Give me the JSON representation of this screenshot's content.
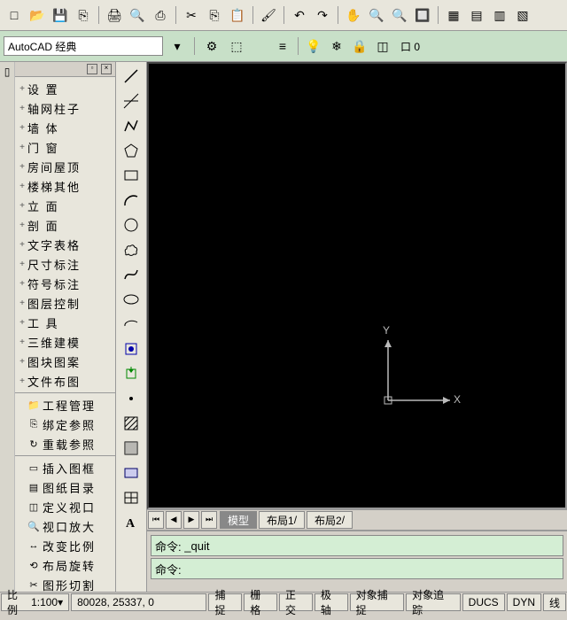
{
  "workspace": {
    "label": "AutoCAD 经典"
  },
  "top_tools": [
    {
      "name": "new-icon",
      "glyph": "□"
    },
    {
      "name": "open-icon",
      "glyph": "📂"
    },
    {
      "name": "save-icon",
      "glyph": "💾"
    },
    {
      "name": "saveall-icon",
      "glyph": "⎘"
    },
    {
      "name": "sep"
    },
    {
      "name": "plot-icon",
      "glyph": "🖨"
    },
    {
      "name": "preview-icon",
      "glyph": "🔍"
    },
    {
      "name": "publish-icon",
      "glyph": "⎙"
    },
    {
      "name": "sep"
    },
    {
      "name": "cut-icon",
      "glyph": "✂"
    },
    {
      "name": "copy-icon",
      "glyph": "⎘"
    },
    {
      "name": "paste-icon",
      "glyph": "📋"
    },
    {
      "name": "sep"
    },
    {
      "name": "match-icon",
      "glyph": "🖌"
    },
    {
      "name": "sep"
    },
    {
      "name": "undo-icon",
      "glyph": "↶"
    },
    {
      "name": "redo-icon",
      "glyph": "↷"
    },
    {
      "name": "sep"
    },
    {
      "name": "pan-icon",
      "glyph": "✋"
    },
    {
      "name": "zoom-icon",
      "glyph": "🔍"
    },
    {
      "name": "zoomprev-icon",
      "glyph": "🔍"
    },
    {
      "name": "zoomwin-icon",
      "glyph": "🔲"
    },
    {
      "name": "sep"
    },
    {
      "name": "props-icon",
      "glyph": "▦"
    },
    {
      "name": "dc-icon",
      "glyph": "▤"
    },
    {
      "name": "toolpal-icon",
      "glyph": "▥"
    },
    {
      "name": "markup-icon",
      "glyph": "▧"
    }
  ],
  "layer_tools": [
    {
      "name": "layer-icon",
      "glyph": "≡"
    },
    {
      "name": "sep"
    },
    {
      "name": "layeron-icon",
      "glyph": "💡"
    },
    {
      "name": "layerfrz-icon",
      "glyph": "❄"
    },
    {
      "name": "layerlock-icon",
      "glyph": "🔒"
    },
    {
      "name": "layercolor-icon",
      "glyph": "◫"
    }
  ],
  "layer_current": "口 0",
  "left_groups": [
    {
      "items": [
        {
          "exp": "+",
          "label": "设 置"
        },
        {
          "exp": "+",
          "label": "轴网柱子"
        },
        {
          "exp": "+",
          "label": "墙 体"
        },
        {
          "exp": "+",
          "label": "门 窗"
        },
        {
          "exp": "+",
          "label": "房间屋顶"
        },
        {
          "exp": "+",
          "label": "楼梯其他"
        },
        {
          "exp": "+",
          "label": "立 面"
        },
        {
          "exp": "+",
          "label": "剖 面"
        },
        {
          "exp": "+",
          "label": "文字表格"
        },
        {
          "exp": "+",
          "label": "尺寸标注"
        },
        {
          "exp": "+",
          "label": "符号标注"
        },
        {
          "exp": "+",
          "label": "图层控制"
        },
        {
          "exp": "+",
          "label": "工 具"
        },
        {
          "exp": "+",
          "label": "三维建模"
        },
        {
          "exp": "+",
          "label": "图块图案"
        },
        {
          "exp": "+",
          "label": "文件布图"
        }
      ]
    },
    {
      "items": [
        {
          "icon": "📁",
          "label": "工程管理"
        },
        {
          "icon": "⎘",
          "label": "绑定参照"
        },
        {
          "icon": "↻",
          "label": "重载参照"
        }
      ]
    },
    {
      "items": [
        {
          "icon": "▭",
          "label": "插入图框"
        },
        {
          "icon": "▤",
          "label": "图纸目录"
        },
        {
          "icon": "◫",
          "label": "定义视口"
        },
        {
          "icon": "🔍",
          "label": "视口放大"
        },
        {
          "icon": "↔",
          "label": "改变比例"
        },
        {
          "icon": "⟲",
          "label": "布局旋转"
        },
        {
          "icon": "✂",
          "label": "图形切割"
        }
      ]
    }
  ],
  "draw_tools": [
    {
      "name": "line-icon",
      "svg": "line"
    },
    {
      "name": "xline-icon",
      "svg": "xline"
    },
    {
      "name": "pline-icon",
      "svg": "pline"
    },
    {
      "name": "polygon-icon",
      "svg": "polygon"
    },
    {
      "name": "rect-icon",
      "svg": "rect"
    },
    {
      "name": "arc-icon",
      "svg": "arc"
    },
    {
      "name": "circle-icon",
      "svg": "circle"
    },
    {
      "name": "revcloud-icon",
      "svg": "cloud"
    },
    {
      "name": "spline-icon",
      "svg": "spline"
    },
    {
      "name": "ellipse-icon",
      "svg": "ellipse"
    },
    {
      "name": "ellipsearc-icon",
      "svg": "ellipsearc"
    },
    {
      "name": "block-icon",
      "svg": "block"
    },
    {
      "name": "insert-icon",
      "svg": "insert"
    },
    {
      "name": "point-icon",
      "svg": "point"
    },
    {
      "name": "hatch-icon",
      "svg": "hatch"
    },
    {
      "name": "gradient-icon",
      "svg": "gradient"
    },
    {
      "name": "region-icon",
      "svg": "region"
    },
    {
      "name": "table-icon",
      "svg": "table"
    },
    {
      "name": "text-icon",
      "svg": "text"
    }
  ],
  "ucs": {
    "x": "X",
    "y": "Y"
  },
  "tabs": {
    "model": "模型",
    "layout1": "布局1",
    "layout2": "布局2"
  },
  "command": {
    "prompt1_label": "命令:",
    "prompt1_value": "_quit",
    "prompt2_label": "命令:"
  },
  "status": {
    "scale_label": "比例",
    "scale_value": "1:100",
    "coords": "80028, 25337, 0",
    "modes": [
      "捕捉",
      "栅格",
      "正交",
      "极轴",
      "对象捕捉",
      "对象追踪",
      "DUCS",
      "DYN",
      "线"
    ]
  }
}
